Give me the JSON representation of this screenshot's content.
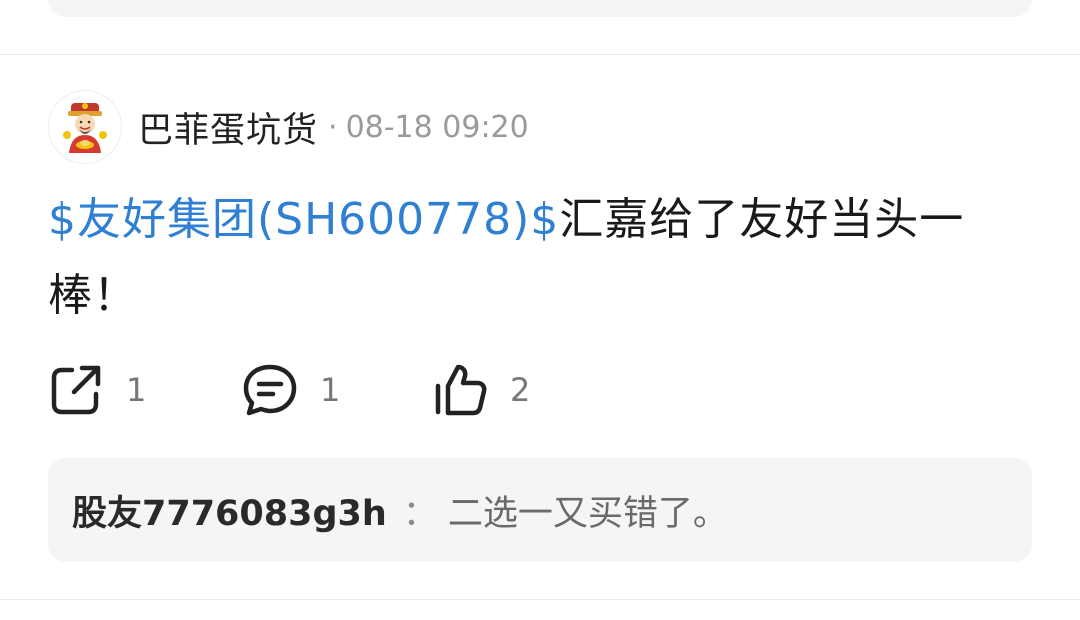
{
  "post": {
    "author": "巴菲蛋坑货",
    "meta_separator": "·",
    "timestamp": "08-18 09:20",
    "stock_link": "$友好集团(SH600778)$",
    "content_text": "汇嘉给了友好当头一棒！",
    "actions": {
      "share_count": "1",
      "comment_count": "1",
      "like_count": "2"
    },
    "reply": {
      "user": "股友7776083g3h",
      "separator": "：",
      "text": "二选一又买错了。"
    }
  },
  "icons": {
    "share": "share-icon",
    "comment": "comment-icon",
    "like": "thumbs-up-icon",
    "avatar": "caishen-avatar"
  },
  "colors": {
    "link": "#2f7fd3",
    "meta": "#9a9a9a",
    "reply_bg": "#f5f5f7"
  }
}
